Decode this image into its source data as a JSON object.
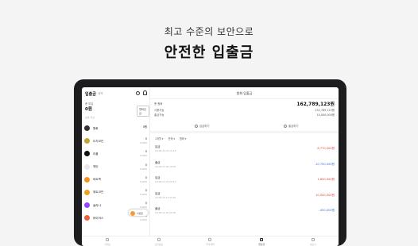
{
  "hero": {
    "line1": "최고 수준의 보안으로",
    "line2": "안전한 입출금"
  },
  "left": {
    "title": "입출금",
    "subtitle": "내역",
    "total_label": "총 보유",
    "total_value": "0원",
    "total_button": "원화입금",
    "section_label": "보유 자산",
    "items": [
      {
        "name": "원화",
        "amount": "0원",
        "sub": "",
        "color": "#333333"
      },
      {
        "name": "도지코인",
        "amount": "0",
        "sub": "0 KRW",
        "color": "#c2a633"
      },
      {
        "name": "리플",
        "amount": "0",
        "sub": "0 KRW",
        "color": "#111111"
      },
      {
        "name": "체인",
        "amount": "0",
        "sub": "0 KRW",
        "color": "#e8e8e8"
      },
      {
        "name": "비트맥",
        "amount": "0",
        "sub": "0 KRW",
        "color": "#f7931a"
      },
      {
        "name": "위트코인",
        "amount": "0",
        "sub": "0 KRW",
        "color": "#f0a020"
      },
      {
        "name": "솔라나",
        "amount": "0",
        "sub": "0 KRW",
        "color": "#9945ff"
      },
      {
        "name": "바이어스",
        "amount": "0",
        "sub": "0 KRW",
        "color": "#f25d3c"
      }
    ],
    "pill_label": "이벤트"
  },
  "right": {
    "title": "원화 입출금",
    "balance_label": "총 원화",
    "balance_value": "162,789,123원",
    "row2_label": "사용가능",
    "row2_value": "152,789,123원",
    "row3_label": "출금가능",
    "row3_value": "10,000,000원",
    "deposit_label": "입금하기",
    "withdraw_label": "출금하기",
    "filters": [
      "1개월 ▾",
      "전체 ▾",
      "원화 ▾"
    ],
    "transactions": [
      {
        "title": "입금",
        "date": "19-06-15 12:13:13",
        "amount": "8,770,000원",
        "kind": "red"
      },
      {
        "title": "출금",
        "date": "19-06-12 20:10:09",
        "amount": "-10,700,000원",
        "kind": "blue"
      },
      {
        "title": "입금",
        "date": "19-06-12 15:03:51",
        "amount": "1,800,000원",
        "kind": "red"
      },
      {
        "title": "입금",
        "date": "19-06-10 13:33:35",
        "amount": "10,000,000원",
        "kind": "red"
      },
      {
        "title": "출금",
        "date": "19-06-10 10:22:06",
        "amount": "-400,000원",
        "kind": "blue"
      }
    ]
  },
  "tabs": [
    {
      "label": "거래소",
      "active": false
    },
    {
      "label": "코인정보",
      "active": false
    },
    {
      "label": "투자내역",
      "active": false
    },
    {
      "label": "입출금",
      "active": true
    },
    {
      "label": "더보기",
      "active": false
    }
  ]
}
